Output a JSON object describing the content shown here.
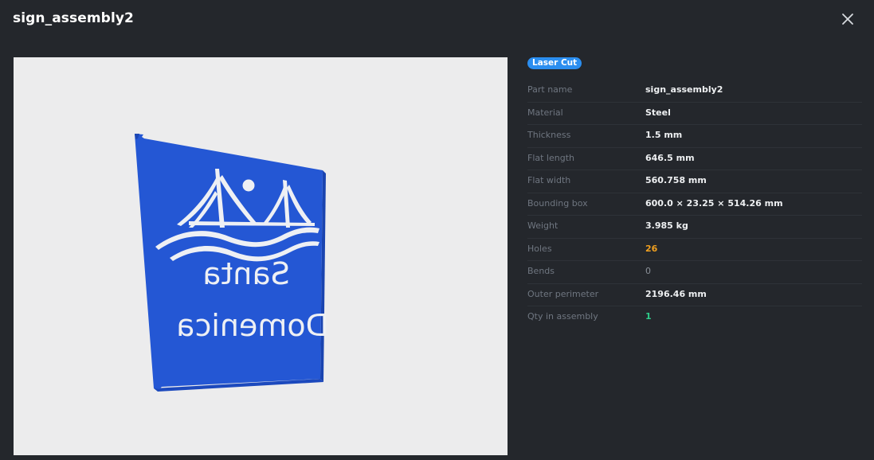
{
  "dialog": {
    "title": "sign_assembly2"
  },
  "badge": {
    "label": "Laser Cut",
    "color": "#2b8ef0"
  },
  "viewer": {
    "sign_color": "#2457d4",
    "sign_text_line1": "Santa",
    "sign_text_line2": "Domenica"
  },
  "properties": [
    {
      "label": "Part name",
      "value": "sign_assembly2",
      "style": "normal"
    },
    {
      "label": "Material",
      "value": "Steel",
      "style": "normal"
    },
    {
      "label": "Thickness",
      "value": "1.5 mm",
      "style": "normal"
    },
    {
      "label": "Flat length",
      "value": "646.5 mm",
      "style": "normal"
    },
    {
      "label": "Flat width",
      "value": "560.758 mm",
      "style": "normal"
    },
    {
      "label": "Bounding box",
      "value": "600.0 × 23.25 × 514.26 mm",
      "style": "normal"
    },
    {
      "label": "Weight",
      "value": "3.985 kg",
      "style": "normal"
    },
    {
      "label": "Holes",
      "value": "26",
      "style": "orange"
    },
    {
      "label": "Bends",
      "value": "0",
      "style": "muted"
    },
    {
      "label": "Outer perimeter",
      "value": "2196.46 mm",
      "style": "normal"
    },
    {
      "label": "Qty in assembly",
      "value": "1",
      "style": "green"
    }
  ]
}
